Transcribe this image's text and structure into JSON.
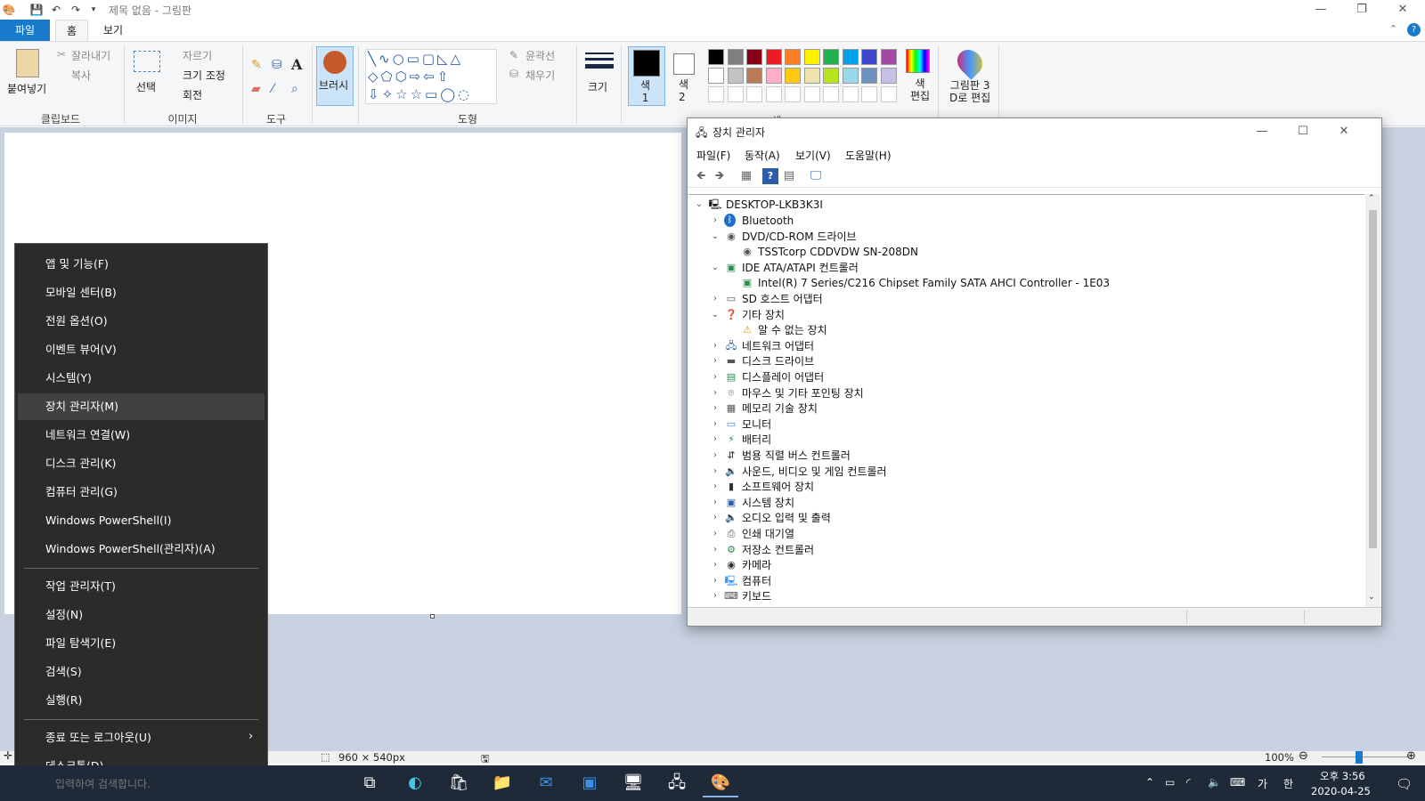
{
  "paint": {
    "title": "제목 없음 - 그림판",
    "tabs": {
      "file": "파일",
      "home": "홈",
      "view": "보기"
    },
    "clipboard": {
      "paste": "붙여넣기",
      "cut": "잘라내기",
      "copy": "복사",
      "group": "클립보드"
    },
    "image": {
      "select": "선택",
      "crop": "자르기",
      "resize": "크기 조정",
      "rotate": "회전",
      "group": "이미지"
    },
    "tools": {
      "group": "도구"
    },
    "brush": {
      "label": "브러시"
    },
    "shapes": {
      "outline": "윤곽선",
      "fill": "채우기",
      "group": "도형"
    },
    "size": {
      "label": "크기"
    },
    "colors": {
      "color1": "색\n1",
      "color2": "색\n2",
      "edit": "색\n편집",
      "group": "색",
      "palette_row1": [
        "#000000",
        "#7f7f7f",
        "#880015",
        "#ed1c24",
        "#ff7f27",
        "#fff200",
        "#22b14c",
        "#00a2e8",
        "#3f48cc",
        "#a349a4"
      ],
      "palette_row2": [
        "#ffffff",
        "#c3c3c3",
        "#b97a57",
        "#ffaec9",
        "#ffc90e",
        "#efe4b0",
        "#b5e61d",
        "#99d9ea",
        "#7092be",
        "#c8bfe7"
      ]
    },
    "paint3d": {
      "label": "그림판 3\nD로 편집"
    },
    "status": {
      "size": "960 × 540px",
      "zoom": "100%"
    }
  },
  "context_menu": {
    "items": [
      "앱 및 기능(F)",
      "모바일 센터(B)",
      "전원 옵션(O)",
      "이벤트 뷰어(V)",
      "시스템(Y)",
      "장치 관리자(M)",
      "네트워크 연결(W)",
      "디스크 관리(K)",
      "컴퓨터 관리(G)",
      "Windows PowerShell(I)",
      "Windows PowerShell(관리자)(A)"
    ],
    "items2": [
      "작업 관리자(T)",
      "설정(N)",
      "파일 탐색기(E)",
      "검색(S)",
      "실행(R)"
    ],
    "shutdown": "종료 또는 로그아웃(U)",
    "desktop": "데스크톱(D)",
    "highlighted": "장치 관리자(M)"
  },
  "device_manager": {
    "title": "장치 관리자",
    "menus": [
      "파일(F)",
      "동작(A)",
      "보기(V)",
      "도움말(H)"
    ],
    "root": "DESKTOP-LKB3K3I",
    "nodes": [
      {
        "label": "Bluetooth",
        "level": 1,
        "exp": "collapsed",
        "icon": "bluetooth-icon"
      },
      {
        "label": "DVD/CD-ROM 드라이브",
        "level": 1,
        "exp": "expanded",
        "icon": "dvd-drive-icon"
      },
      {
        "label": "TSSTcorp CDDVDW SN-208DN",
        "level": 2,
        "exp": "none",
        "icon": "dvd-drive-icon"
      },
      {
        "label": "IDE ATA/ATAPI 컨트롤러",
        "level": 1,
        "exp": "expanded",
        "icon": "ide-controller-icon"
      },
      {
        "label": "Intel(R) 7 Series/C216 Chipset Family SATA AHCI Controller - 1E03",
        "level": 2,
        "exp": "none",
        "icon": "ide-controller-icon"
      },
      {
        "label": "SD 호스트 어댑터",
        "level": 1,
        "exp": "collapsed",
        "icon": "sd-host-icon"
      },
      {
        "label": "기타 장치",
        "level": 1,
        "exp": "expanded",
        "icon": "other-devices-icon"
      },
      {
        "label": "알 수 없는 장치",
        "level": 2,
        "exp": "none",
        "icon": "warning-device-icon"
      },
      {
        "label": "네트워크 어댑터",
        "level": 1,
        "exp": "collapsed",
        "icon": "network-adapter-icon"
      },
      {
        "label": "디스크 드라이브",
        "level": 1,
        "exp": "collapsed",
        "icon": "disk-drive-icon"
      },
      {
        "label": "디스플레이 어댑터",
        "level": 1,
        "exp": "collapsed",
        "icon": "display-adapter-icon"
      },
      {
        "label": "마우스 및 기타 포인팅 장치",
        "level": 1,
        "exp": "collapsed",
        "icon": "mouse-icon"
      },
      {
        "label": "메모리 기술 장치",
        "level": 1,
        "exp": "collapsed",
        "icon": "memory-icon"
      },
      {
        "label": "모니터",
        "level": 1,
        "exp": "collapsed",
        "icon": "monitor-icon"
      },
      {
        "label": "배터리",
        "level": 1,
        "exp": "collapsed",
        "icon": "battery-icon"
      },
      {
        "label": "범용 직렬 버스 컨트롤러",
        "level": 1,
        "exp": "collapsed",
        "icon": "usb-icon"
      },
      {
        "label": "사운드, 비디오 및 게임 컨트롤러",
        "level": 1,
        "exp": "collapsed",
        "icon": "sound-icon"
      },
      {
        "label": "소프트웨어 장치",
        "level": 1,
        "exp": "collapsed",
        "icon": "software-device-icon"
      },
      {
        "label": "시스템 장치",
        "level": 1,
        "exp": "collapsed",
        "icon": "system-device-icon"
      },
      {
        "label": "오디오 입력 및 출력",
        "level": 1,
        "exp": "collapsed",
        "icon": "audio-io-icon"
      },
      {
        "label": "인쇄 대기열",
        "level": 1,
        "exp": "collapsed",
        "icon": "printer-icon"
      },
      {
        "label": "저장소 컨트롤러",
        "level": 1,
        "exp": "collapsed",
        "icon": "storage-controller-icon"
      },
      {
        "label": "카메라",
        "level": 1,
        "exp": "collapsed",
        "icon": "camera-icon"
      },
      {
        "label": "컴퓨터",
        "level": 1,
        "exp": "collapsed",
        "icon": "computer-icon"
      },
      {
        "label": "키보드",
        "level": 1,
        "exp": "collapsed",
        "icon": "keyboard-icon"
      }
    ]
  },
  "taskbar": {
    "time": "오후 3:56",
    "date": "2020-04-25",
    "ime1": "가",
    "ime2": "한",
    "search_text": "입력하여 검색합니다."
  }
}
